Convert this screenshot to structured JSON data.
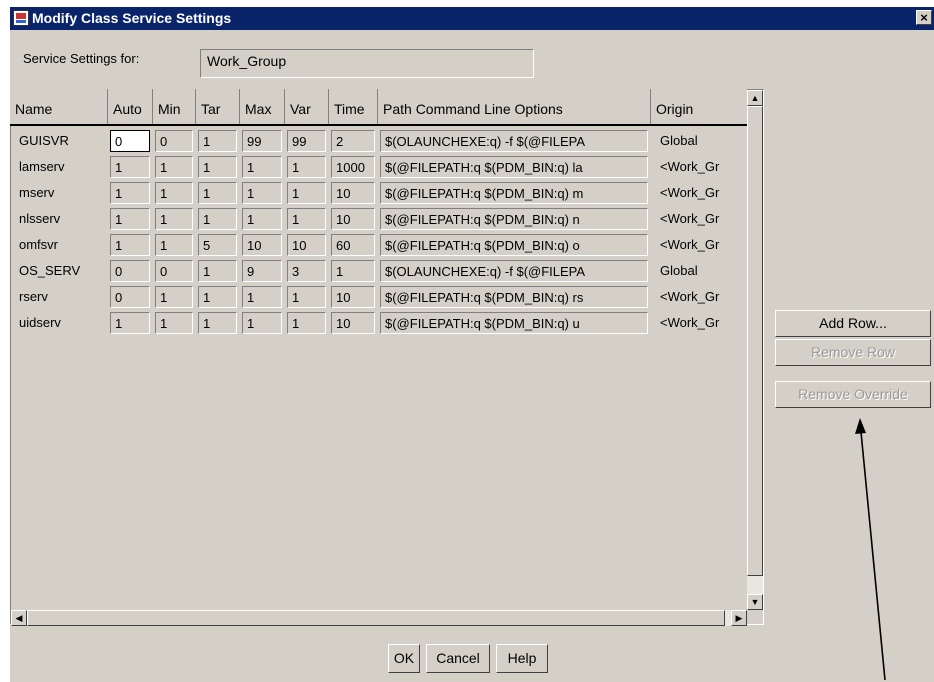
{
  "window": {
    "title": "Modify Class Service Settings",
    "close_glyph": "×"
  },
  "service": {
    "label": "Service Settings for:",
    "value": "Work_Group"
  },
  "table": {
    "columns": [
      "Name",
      "Auto",
      "Min",
      "Tar",
      "Max",
      "Var",
      "Time",
      "Path Command Line Options",
      "Origin"
    ],
    "rows": [
      [
        "GUISVR",
        "0",
        "0",
        "1",
        "99",
        "99",
        "2",
        "$(OLAUNCHEXE:q) -f $(@FILEPA",
        "Global"
      ],
      [
        "lamserv",
        "1",
        "1",
        "1",
        "1",
        "1",
        "1000",
        "$(@FILEPATH:q $(PDM_BIN:q) la",
        "<Work_Gr"
      ],
      [
        "mserv",
        "1",
        "1",
        "1",
        "1",
        "1",
        "10",
        "$(@FILEPATH:q $(PDM_BIN:q) m",
        "<Work_Gr"
      ],
      [
        "nlsserv",
        "1",
        "1",
        "1",
        "1",
        "1",
        "10",
        "$(@FILEPATH:q $(PDM_BIN:q) n",
        "<Work_Gr"
      ],
      [
        "omfsvr",
        "1",
        "1",
        "5",
        "10",
        "10",
        "60",
        "$(@FILEPATH:q $(PDM_BIN:q) o",
        "<Work_Gr"
      ],
      [
        "OS_SERV",
        "0",
        "0",
        "1",
        "9",
        "3",
        "1",
        "$(OLAUNCHEXE:q) -f $(@FILEPA",
        "Global"
      ],
      [
        "rserv",
        "0",
        "1",
        "1",
        "1",
        "1",
        "10",
        "$(@FILEPATH:q $(PDM_BIN:q) rs",
        "<Work_Gr"
      ],
      [
        "uidserv",
        "1",
        "1",
        "1",
        "1",
        "1",
        "10",
        "$(@FILEPATH:q $(PDM_BIN:q) u",
        "<Work_Gr"
      ]
    ]
  },
  "side_buttons": {
    "add_row": "Add Row...",
    "remove_row": "Remove Row",
    "remove_override": "Remove Override"
  },
  "footer_buttons": {
    "ok": "OK",
    "cancel": "Cancel",
    "help": "Help"
  }
}
